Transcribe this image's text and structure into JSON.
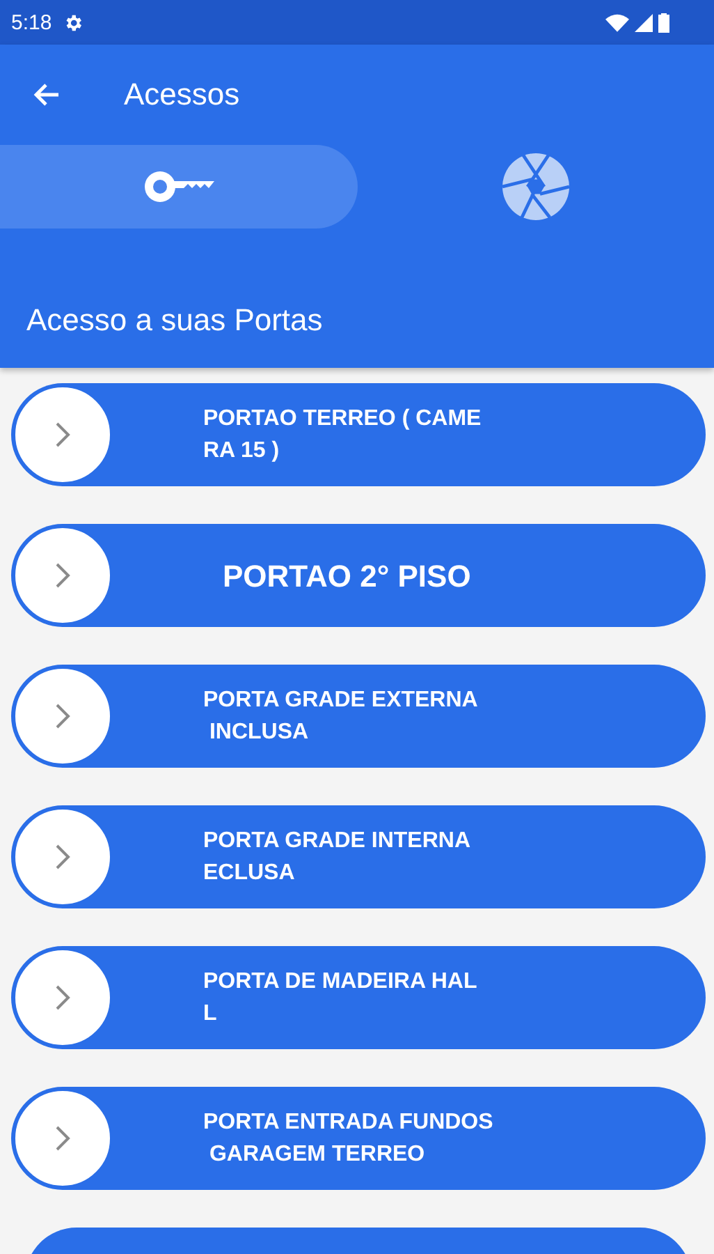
{
  "status_bar": {
    "time": "5:18"
  },
  "app_bar": {
    "title": "Acessos"
  },
  "tabs": [
    {
      "kind": "key",
      "selected": true
    },
    {
      "kind": "aperture",
      "selected": false
    }
  ],
  "section_title": "Acesso a suas Portas",
  "doors": [
    {
      "kind": "normal",
      "label_lines": [
        "PORTAO TERREO ( CAME",
        "RA 15 )"
      ]
    },
    {
      "kind": "large",
      "label_lines": [
        "PORTAO 2° PISO"
      ]
    },
    {
      "kind": "normal",
      "label_lines": [
        "PORTA GRADE EXTERNA",
        " INCLUSA"
      ]
    },
    {
      "kind": "normal",
      "label_lines": [
        "PORTA GRADE INTERNA",
        "ECLUSA"
      ]
    },
    {
      "kind": "normal",
      "label_lines": [
        "PORTA DE MADEIRA HAL",
        "L"
      ]
    },
    {
      "kind": "normal",
      "label_lines": [
        "PORTA ENTRADA FUNDOS",
        " GARAGEM TERREO"
      ]
    }
  ]
}
